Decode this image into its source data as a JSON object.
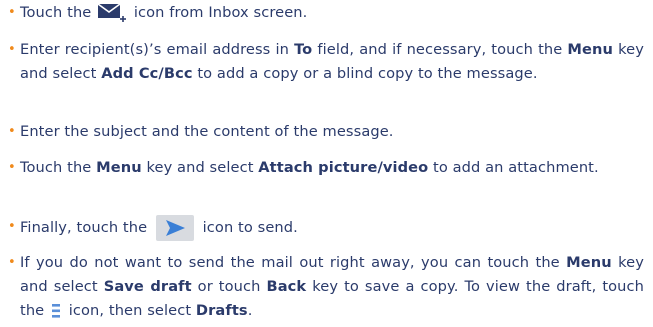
{
  "colors": {
    "text": "#2b3b6b",
    "bullet": "#f08a1c",
    "icon_navy": "#2b3b6b",
    "send_bg": "#d8dbe0",
    "send_arrow": "#3a7fd6",
    "menu_icon": "#5a8fd8"
  },
  "icons": {
    "compose": "new-mail-envelope-icon",
    "send": "send-arrow-icon",
    "menu": "menu-list-icon"
  },
  "bullet": "•",
  "steps": [
    {
      "p1": "Touch the ",
      "p2": " icon from Inbox screen."
    },
    {
      "p1": "Enter recipient(s)’s email address in ",
      "b1": "To",
      "p2": " field, and if necessary, touch the ",
      "b2": "Menu",
      "p3": " key and select ",
      "b3": "Add Cc/Bcc",
      "p4": " to add a copy or a blind copy to the message."
    },
    {
      "p1": "Enter the subject and the content of the message."
    },
    {
      "p1": "Touch the ",
      "b1": "Menu",
      "p2": " key and select ",
      "b2": "Attach picture/video",
      "p3": " to add an attachment."
    },
    {
      "p1": "Finally, touch the ",
      "p2": " icon to send."
    },
    {
      "p1": "If you do not want to send the mail out right away, you can touch the ",
      "b1": "Menu",
      "p2": " key and select ",
      "b2": "Save draft",
      "p3": " or touch ",
      "b3": "Back",
      "p4": " key to save a copy. To view the draft, touch the ",
      "p5": " icon, then select ",
      "b4": "Drafts",
      "p6": "."
    }
  ]
}
